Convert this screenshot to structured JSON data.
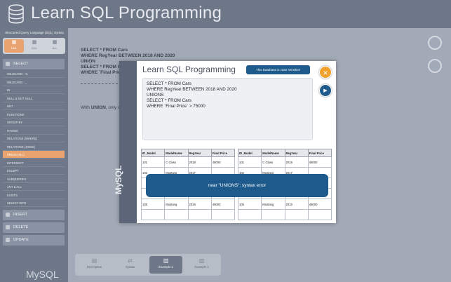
{
  "header": {
    "title": "Learn SQL Programming",
    "icon": "database-icon"
  },
  "sidebar": {
    "subtitle": "Structured Query Language (SQL) Syntax",
    "segments": [
      {
        "label": "DML",
        "active": true
      },
      {
        "label": "DDL",
        "active": false
      },
      {
        "label": "ALL",
        "active": false
      }
    ],
    "select_label": "SELECT",
    "items": [
      "WILDCARD : %",
      "WILDCARD : _",
      "IN",
      "NULL & NOT NULL",
      "NOT",
      "FUNCTIONS",
      "GROUP BY",
      "HAVING",
      "RELATIONS (WHERE)",
      "RELATIONS (JOINS)",
      "UNION (ALL)",
      "INTERSECT",
      "EXCEPT",
      "SUBQUERIES",
      "ANY & ALL",
      "EXISTS",
      "SELECT INTO"
    ],
    "selected_index": 10,
    "sections": [
      "INSERT",
      "DELETE",
      "UPDATE"
    ],
    "footer": "MySQL"
  },
  "main": {
    "sql_lines": [
      "SELECT * FROM Cars",
      "WHERE RegYear BETWEEN 2018 AND 2020",
      "UNION",
      "SELECT * FROM Cars",
      "WHERE `Final Price"
    ],
    "note_prefix": "With ",
    "note_bold": "UNION",
    "note_rest": ", only d"
  },
  "tabs": [
    {
      "label": "Description",
      "active": false
    },
    {
      "label": "Syntax",
      "active": false
    },
    {
      "label": "Example 1",
      "active": true
    },
    {
      "label": "Example 2",
      "active": false
    }
  ],
  "modal": {
    "title": "Learn SQL Programming",
    "badge": "This Database is case sensitive",
    "rail_text": "MySQL",
    "query_lines": [
      "SELECT * FROM Cars",
      "WHERE RegYear BETWEEN 2018 AND 2020",
      "UNIONS",
      "SELECT * FROM Cars",
      "WHERE `Final Price` > 75000"
    ],
    "error": "near \"UNIONS\": syntax error",
    "table_headers": [
      "ID_Model",
      "ModelName",
      "RegYear",
      "Final Price"
    ],
    "left_rows": [
      [
        "101",
        "C Class",
        "2018",
        "45000"
      ],
      [
        "102",
        "Mustang",
        "2017",
        ""
      ],
      [
        "",
        "",
        "",
        ""
      ],
      [
        "",
        "",
        "",
        ""
      ],
      [
        "105",
        "Mustang",
        "2018",
        "45000"
      ],
      [
        "",
        "",
        "",
        ""
      ]
    ],
    "right_rows": [
      [
        "101",
        "C Class",
        "2018",
        "45000"
      ],
      [
        "102",
        "Mustang",
        "2017",
        ""
      ],
      [
        "",
        "",
        "",
        ""
      ],
      [
        "",
        "",
        "",
        ""
      ],
      [
        "105",
        "Mustang",
        "2018",
        "45000"
      ],
      [
        "",
        "",
        "",
        ""
      ]
    ]
  },
  "colors": {
    "accent": "#e8a36e",
    "primary": "#1e5b8c",
    "sidebar": "#6f7888"
  }
}
